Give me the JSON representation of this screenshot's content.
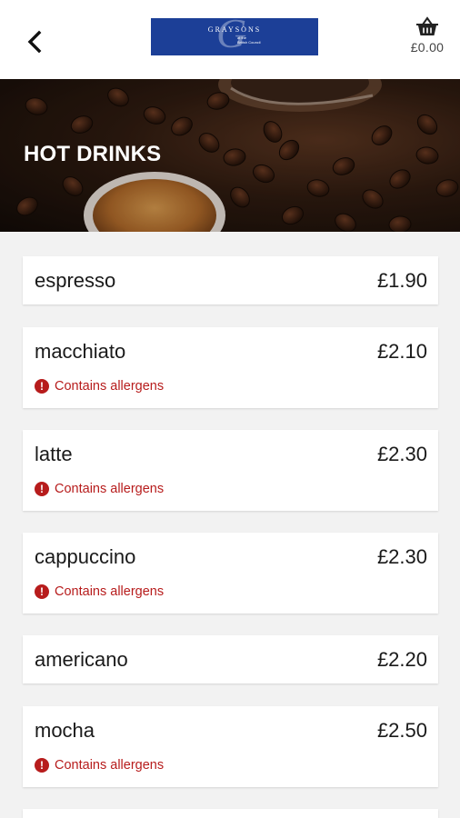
{
  "header": {
    "logo": {
      "name": "GRAYSONS",
      "sub_line1": "at the",
      "sub_line2": "British Council"
    },
    "basket_total": "£0.00"
  },
  "hero": {
    "title": "HOT DRINKS"
  },
  "items": [
    {
      "name": "espresso",
      "price": "£1.90",
      "allergen": ""
    },
    {
      "name": "macchiato",
      "price": "£2.10",
      "allergen": "Contains allergens"
    },
    {
      "name": "latte",
      "price": "£2.30",
      "allergen": "Contains allergens"
    },
    {
      "name": "cappuccino",
      "price": "£2.30",
      "allergen": "Contains allergens"
    },
    {
      "name": "americano",
      "price": "£2.20",
      "allergen": ""
    },
    {
      "name": "mocha",
      "price": "£2.50",
      "allergen": "Contains allergens"
    }
  ],
  "colors": {
    "brand": "#1c3f97",
    "allergen": "#b71c1c",
    "background": "#f2f2f2"
  },
  "icons": {
    "back": "chevron-left-icon",
    "basket": "basket-icon",
    "allergen": "exclamation-circle-icon"
  }
}
